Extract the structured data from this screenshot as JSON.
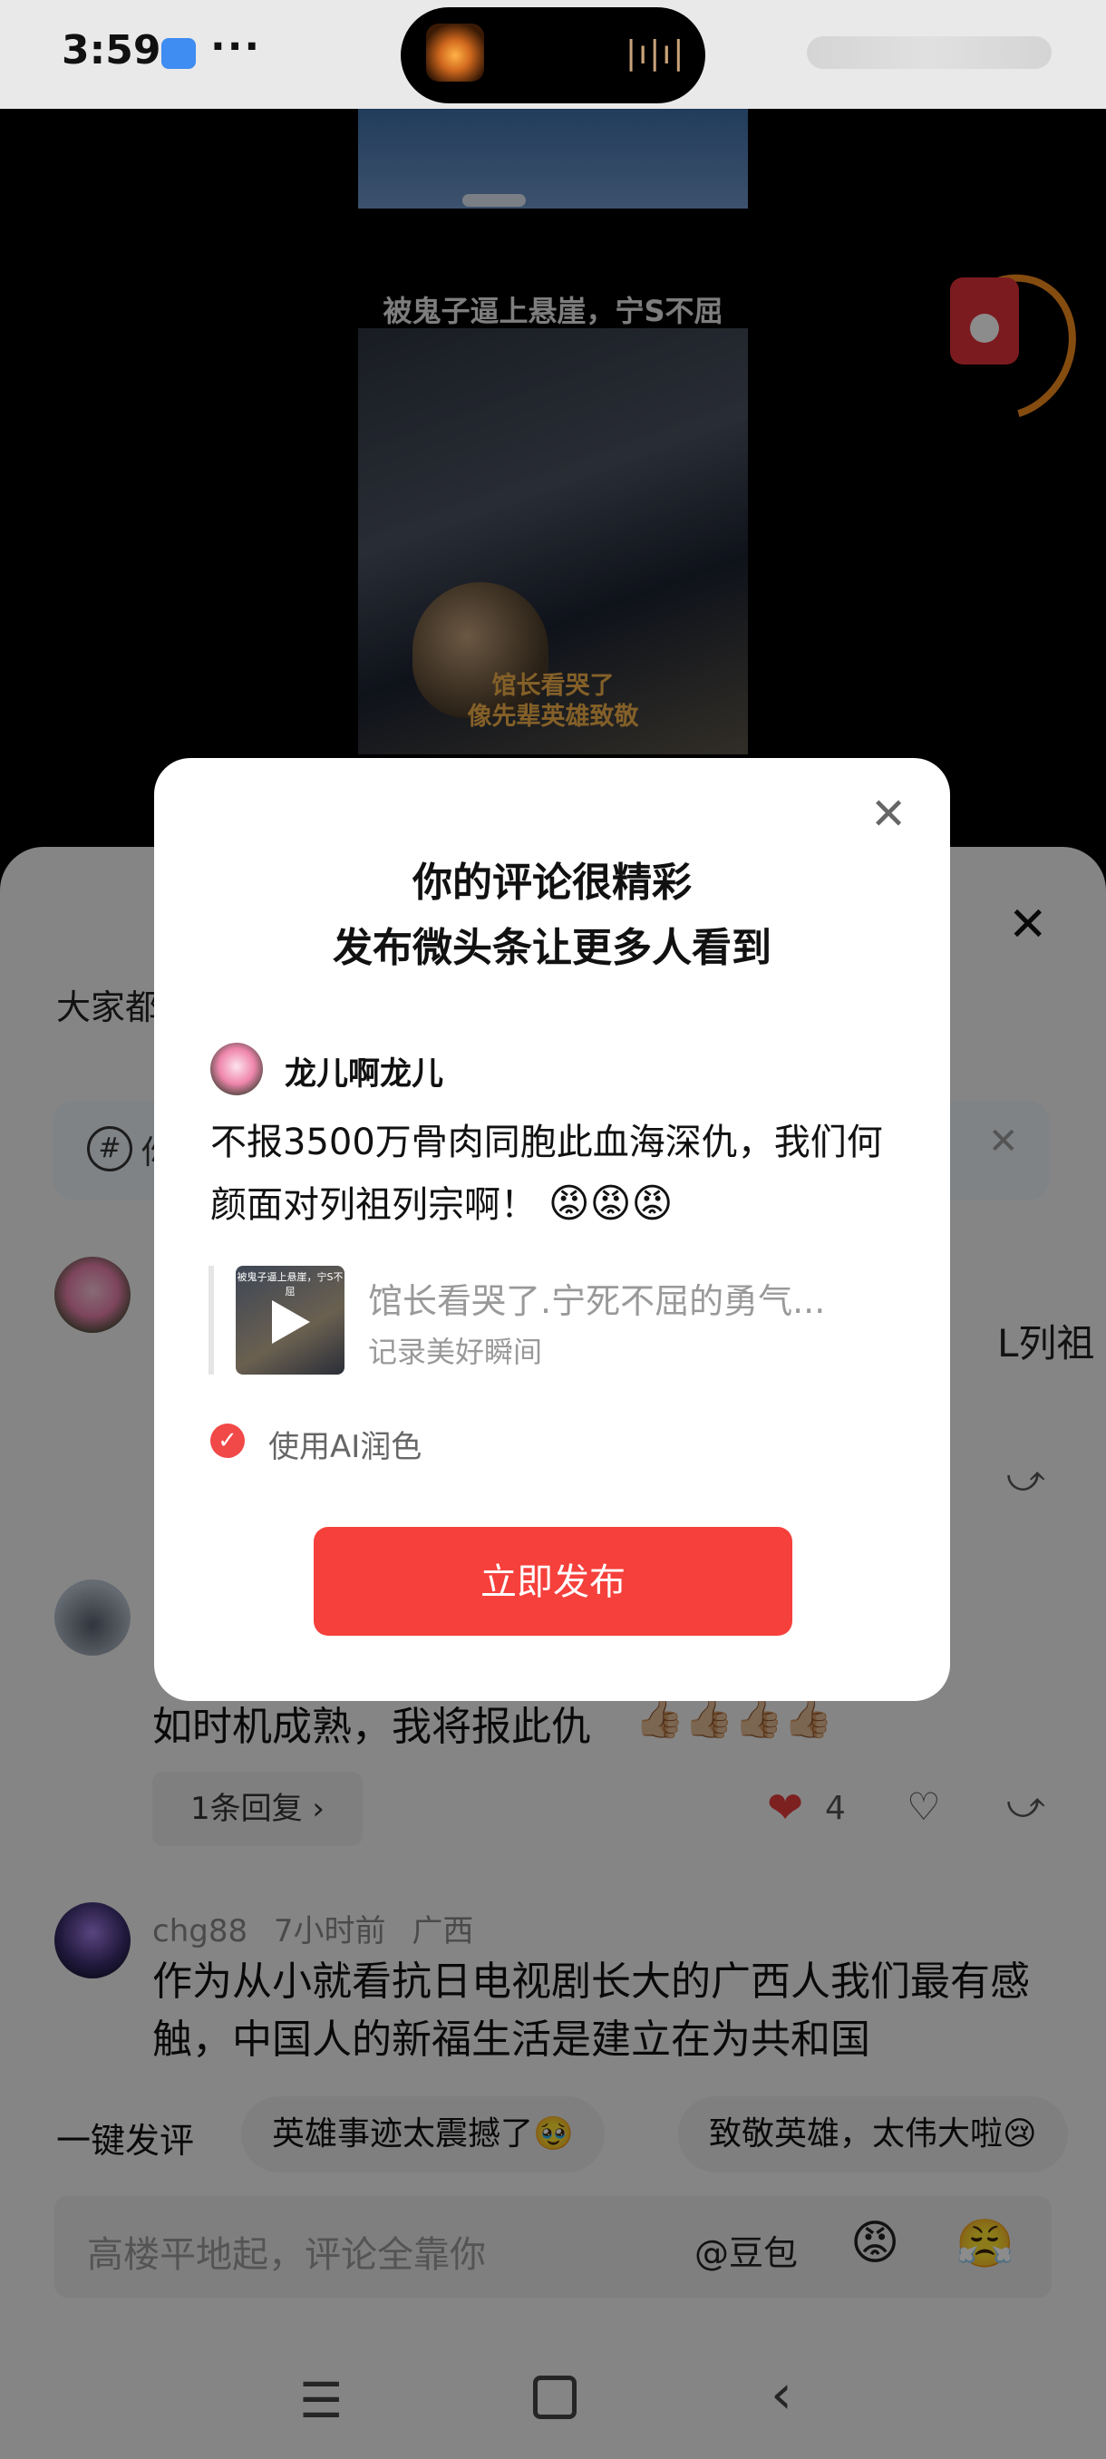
{
  "status_bar": {
    "time": "3:59",
    "dots": "···",
    "island_wave": "|ı|ı|"
  },
  "video": {
    "caption_top": "被鬼子逼上悬崖，宁S不屈",
    "subtitle_line1": "馆长看哭了",
    "subtitle_line2": "像先辈英雄致敬"
  },
  "comment_sheet": {
    "header": "大家都",
    "topic_prefix": "你",
    "comment1_tail": "L列祖",
    "comment2": {
      "text": "如时机成熟，我将报此仇",
      "emojis": "👍🏼👍🏼👍🏼👍🏼",
      "reply_label": "1条回复 ›",
      "like_count": "4"
    },
    "comment3": {
      "user": "chg88",
      "time": "7小时前",
      "location": "广西",
      "text": "作为从小就看抗日电视剧长大的广西人我们最有感触，中国人的新福生活是建立在为共和国"
    }
  },
  "quick_comment": {
    "label": "一键发评",
    "chips": [
      "英雄事迹太震撼了🥹",
      "致敬英雄，太伟大啦😢"
    ]
  },
  "input_bar": {
    "placeholder": "高楼平地起，评论全靠你",
    "at_label": "@豆包",
    "emoji1": "😡",
    "emoji2": "😤"
  },
  "dialog": {
    "title_line1": "你的评论很精彩",
    "title_line2": "发布微头条让更多人看到",
    "user_name": "龙儿啊龙儿",
    "comment_text": "不报3500万骨肉同胞此血海深仇，我们何颜面对列祖列宗啊！",
    "comment_emojis": "😡😡😡",
    "quote_thumb_caption": "被鬼子逼上悬崖，宁S不屈",
    "quote_title": "馆长看哭了.宁死不屈的勇气...",
    "quote_subtitle": "记录美好瞬间",
    "ai_polish_label": "使用AI润色",
    "publish_label": "立即发布"
  },
  "colors": {
    "accent": "#f6403c",
    "like": "#e43b3b",
    "overlay": "rgba(0,0,0,0.45)"
  }
}
